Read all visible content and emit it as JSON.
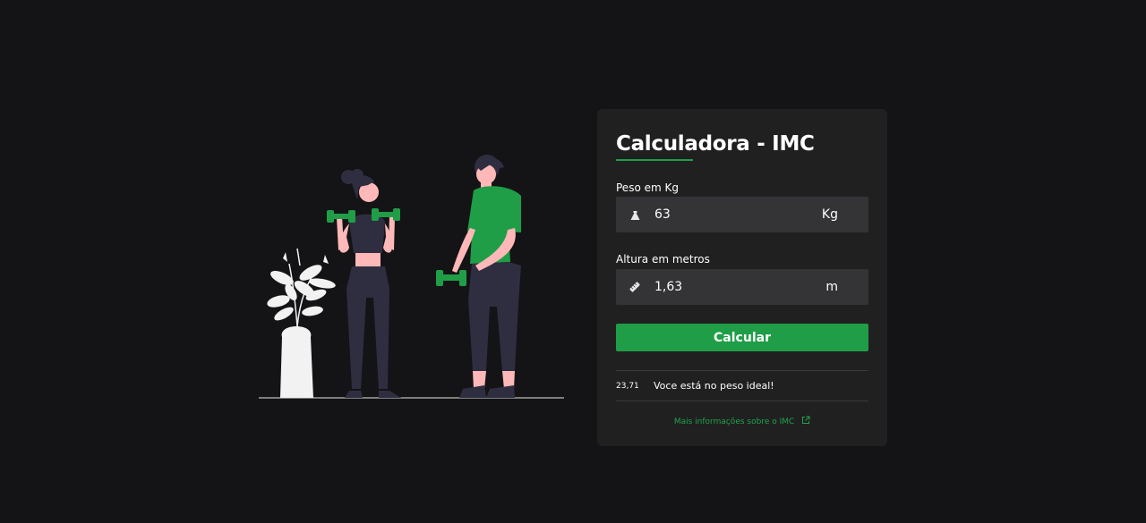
{
  "card": {
    "title": "Calculadora - IMC"
  },
  "weight": {
    "label": "Peso em Kg",
    "value": "63",
    "unit": "Kg",
    "icon": "weight-icon"
  },
  "height": {
    "label": "Altura em metros",
    "value": "1,63",
    "unit": "m",
    "icon": "ruler-icon"
  },
  "calculate_label": "Calcular",
  "result": {
    "value": "23,71",
    "message": "Voce está no peso ideal!"
  },
  "more_info": {
    "label": "Mais informações sobre o IMC",
    "icon": "external-link-icon"
  },
  "colors": {
    "background": "#141416",
    "card": "#202021",
    "field": "#343437",
    "accent": "#1f9e47"
  }
}
